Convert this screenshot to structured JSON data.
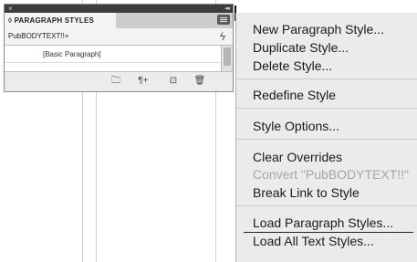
{
  "panel": {
    "title": "◊ PARAGRAPH STYLES",
    "current_style": "PubBODYTEXT!!+",
    "items": [
      "[Basic Paragraph]"
    ],
    "titlebar": {
      "close": "×",
      "collapse": "◂◂"
    },
    "bolt_glyph": "ϟ",
    "footer_icons": [
      "folder-icon",
      "new-style-icon",
      "create-icon",
      "delete-icon"
    ],
    "footer_glyphs": [
      "🗀",
      "¶+",
      "⊡",
      "🗑"
    ]
  },
  "menu": {
    "new_paragraph_style": "New Paragraph Style...",
    "duplicate_style": "Duplicate Style...",
    "delete_style": "Delete Style...",
    "redefine_style": "Redefine Style",
    "style_options": "Style Options...",
    "clear_overrides": "Clear Overrides",
    "convert_style": "Convert \"PubBODYTEXT!!\"",
    "break_link": "Break Link to Style",
    "load_paragraph_styles": "Load Paragraph Styles...",
    "load_all_text_styles": "Load All Text Styles..."
  }
}
